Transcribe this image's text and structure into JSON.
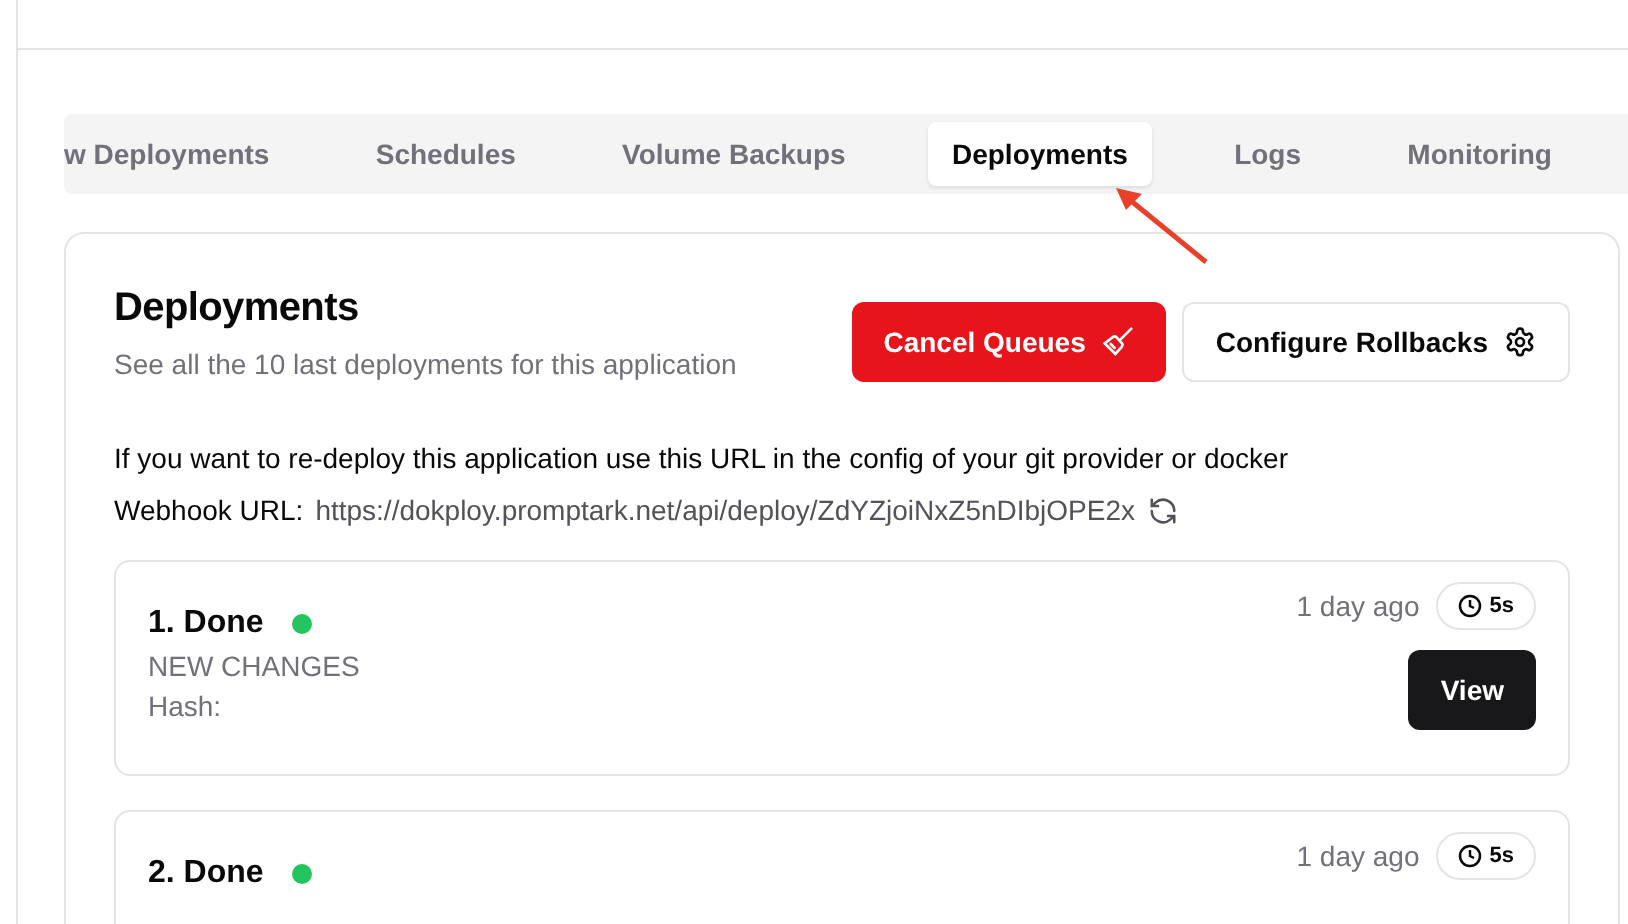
{
  "tabs": [
    {
      "label": "w Deployments",
      "selected": false
    },
    {
      "label": "Schedules",
      "selected": false
    },
    {
      "label": "Volume Backups",
      "selected": false
    },
    {
      "label": "Deployments",
      "selected": true
    },
    {
      "label": "Logs",
      "selected": false
    },
    {
      "label": "Monitoring",
      "selected": false
    }
  ],
  "annotation_arrow": true,
  "panel": {
    "title": "Deployments",
    "subtitle": "See all the 10 last deployments for this application",
    "buttons": [
      {
        "label": "Cancel Queues",
        "kind": "danger"
      },
      {
        "label": "Configure Rollbacks",
        "kind": "outline"
      }
    ],
    "instructions": "If you want to re-deploy this application use this URL in the config of your git provider or docker",
    "webhook_label": "Webhook URL:",
    "webhook_url": "https://dokploy.promptark.net/api/deploy/ZdYZjoiNxZ5nDIbjOPE2x",
    "deployments": [
      {
        "title": "1. Done",
        "color": "#22c55e",
        "message": "NEW CHANGES",
        "hash": "Hash:",
        "time": "1 day ago",
        "duration": "5s",
        "action": "View"
      },
      {
        "title": "2. Done",
        "color": "#22c55e",
        "time": "1 day ago",
        "duration": "5s"
      }
    ]
  }
}
